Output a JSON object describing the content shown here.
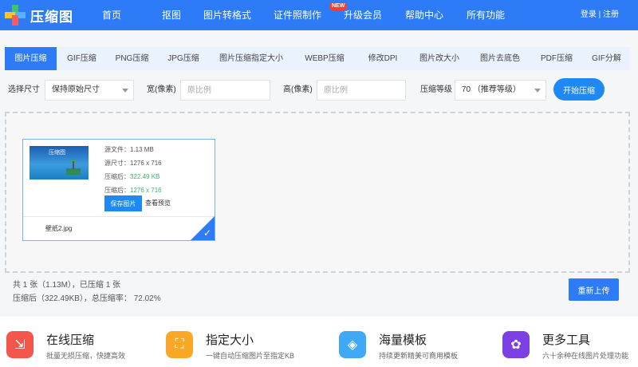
{
  "header": {
    "logo_text": "压缩图",
    "nav": [
      "首页",
      "抠图",
      "图片转格式",
      "证件照制作",
      "升级会员",
      "帮助中心",
      "所有功能"
    ],
    "new_badge": "NEW",
    "login": "登录",
    "separator": "|",
    "register": "注册"
  },
  "tabs": {
    "items": [
      "图片压缩",
      "GIF压缩",
      "PNG压缩",
      "JPG压缩",
      "图片压缩指定大小",
      "WEBP压缩",
      "修改DPI",
      "图片改大小",
      "图片去底色",
      "PDF压缩",
      "GIF分解"
    ],
    "active_index": 0
  },
  "options": {
    "size_label": "选择尺寸",
    "size_value": "保持原始尺寸",
    "width_label": "宽(像素)",
    "width_placeholder": "原比例",
    "height_label": "高(像素)",
    "height_placeholder": "原比例",
    "level_label": "压缩等级",
    "level_value": "70 （推荐等级）",
    "start_button": "开始压缩"
  },
  "file": {
    "watermark": "压缩图",
    "source_file": "源文件：1.13 MB",
    "source_size": "源尺寸：1276 x 716",
    "compressed_file_label": "压缩后：",
    "compressed_file_value": "322.49 KB",
    "compressed_size_label": "压缩后：",
    "compressed_size_value": "1276 x 716",
    "save_button": "保存图片",
    "preview_link": "查看预览",
    "filename": "壁纸2.jpg"
  },
  "summary": {
    "line1": "共 1 张（1.13M），已压缩 1 张",
    "line2": "压缩后（322.49KB），总压缩率：  72.02%",
    "reupload_button": "重新上传"
  },
  "features": [
    {
      "title": "在线压缩",
      "desc": "批量无损压缩，快捷高效",
      "icon": "compress-icon",
      "color": "#f4564b",
      "glyph": "⇲"
    },
    {
      "title": "指定大小",
      "desc": "一键自动压缩图片至指定KB",
      "icon": "resize-icon",
      "color": "#f9a825",
      "glyph": "⛶"
    },
    {
      "title": "海量模板",
      "desc": "持续更新精美可商用模板",
      "icon": "layers-icon",
      "color": "#3fa9f5",
      "glyph": "◈"
    },
    {
      "title": "更多工具",
      "desc": "六十余种在线图片处理功能",
      "icon": "apps-icon",
      "color": "#7b3fe4",
      "glyph": "✿"
    }
  ]
}
